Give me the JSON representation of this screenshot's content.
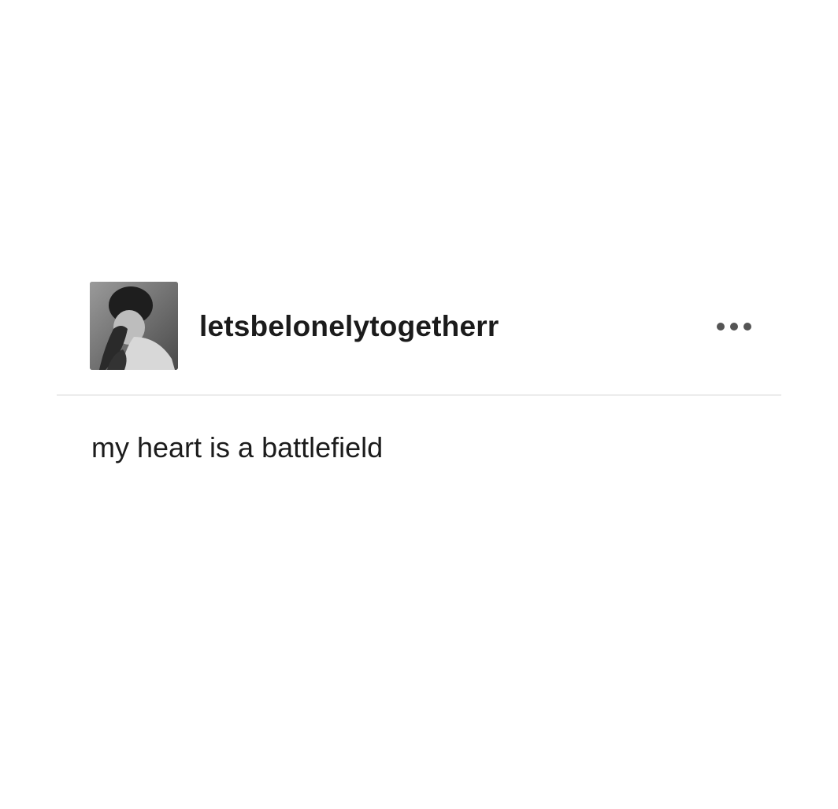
{
  "post": {
    "author": {
      "username": "letsbelonelytogetherr",
      "avatar_icon": "user-avatar-photo"
    },
    "menu_icon": "more-options-icon",
    "content": {
      "text": "my heart is a battlefield"
    }
  },
  "colors": {
    "background": "#ffffff",
    "text": "#1b1b1b",
    "divider": "#ececec",
    "menu_dots": "#555555"
  }
}
